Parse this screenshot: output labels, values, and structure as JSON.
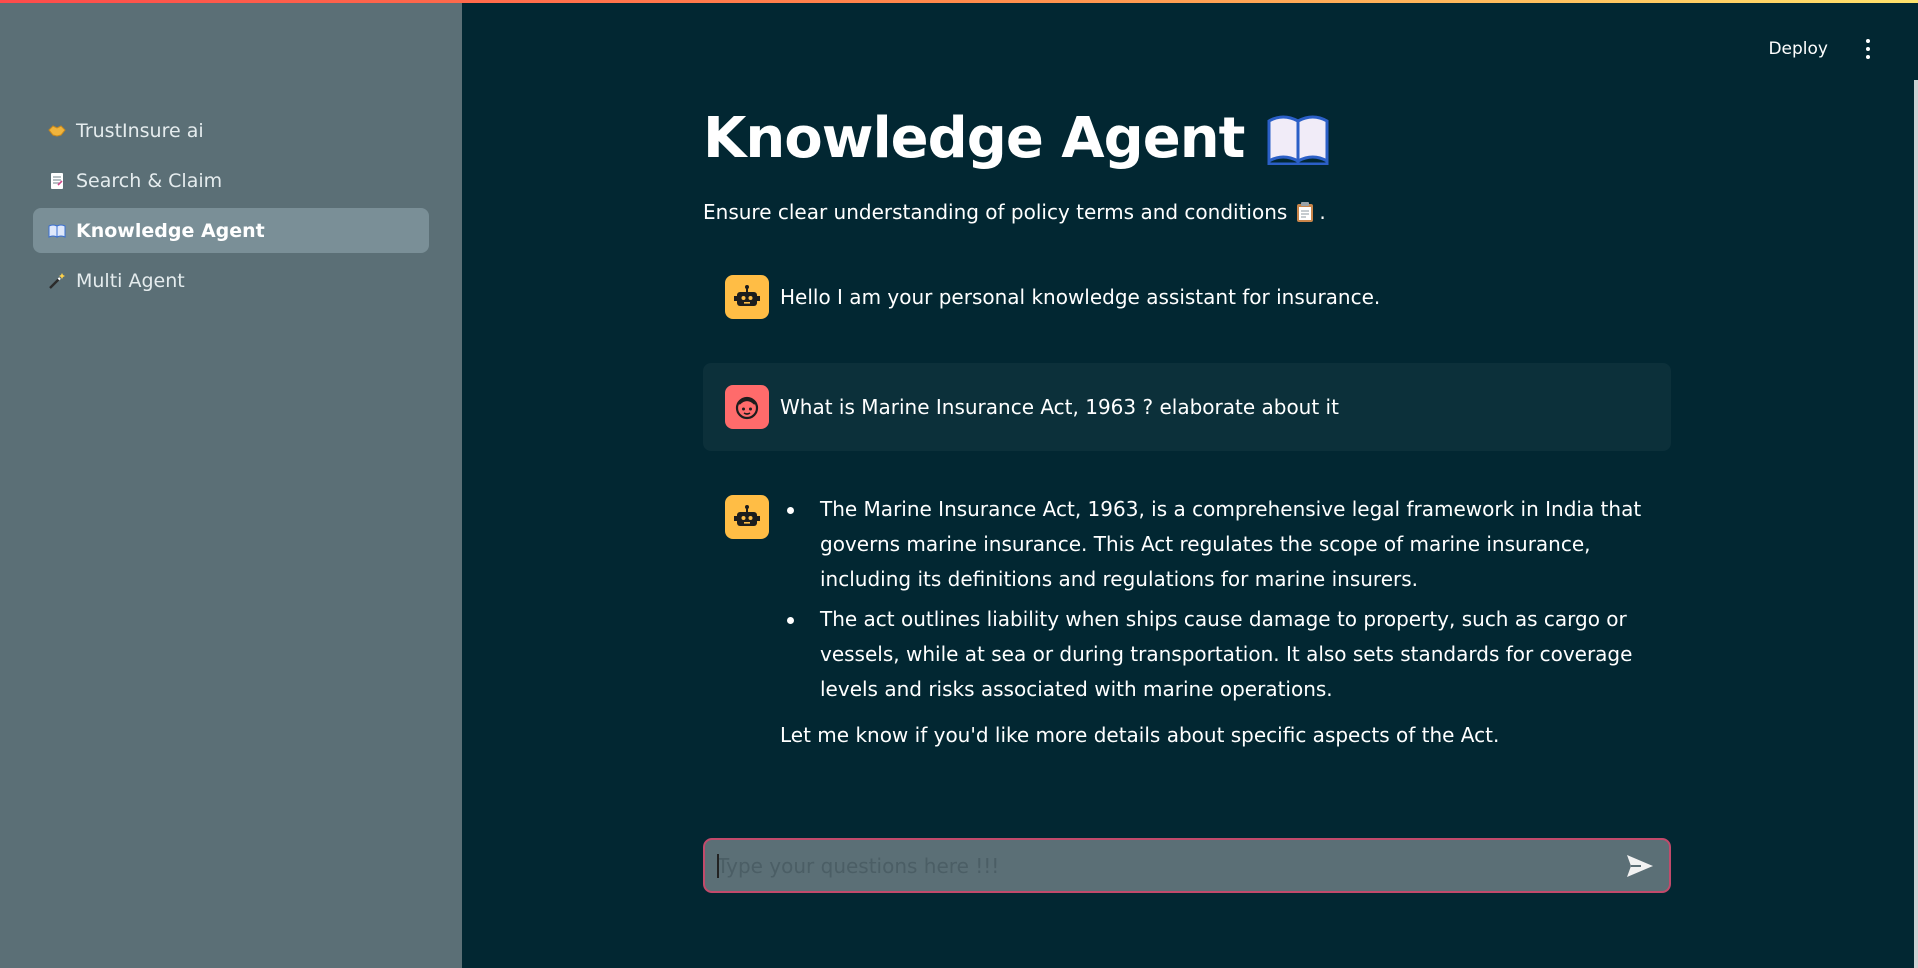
{
  "header": {
    "deploy_label": "Deploy",
    "menu_icon": "kebab-menu-icon"
  },
  "sidebar": {
    "items": [
      {
        "label": "TrustInsure ai",
        "icon": "handshake-icon",
        "active": false
      },
      {
        "label": "Search & Claim",
        "icon": "document-icon",
        "active": false
      },
      {
        "label": "Knowledge Agent",
        "icon": "open-book-icon",
        "active": true
      },
      {
        "label": "Multi Agent",
        "icon": "magic-wand-icon",
        "active": false
      }
    ]
  },
  "main": {
    "title": "Knowledge Agent",
    "title_icon": "open-book-icon",
    "subtitle": "Ensure clear understanding of policy terms and conditions",
    "subtitle_suffix": ".",
    "subtitle_icon": "clipboard-icon"
  },
  "chat": {
    "messages": [
      {
        "role": "assistant",
        "avatar": "robot-icon",
        "text": "Hello I am your personal knowledge assistant for insurance."
      },
      {
        "role": "user",
        "avatar": "face-icon",
        "text": "What is Marine Insurance Act, 1963 ? elaborate about it"
      },
      {
        "role": "assistant",
        "avatar": "robot-icon",
        "bullets": [
          "The Marine Insurance Act, 1963, is a comprehensive legal framework in India that governs marine insurance. This Act regulates the scope of marine insurance, including its definitions and regulations for marine insurers.",
          "The act outlines liability when ships cause damage to property, such as cargo or vessels, while at sea or during transportation. It also sets standards for coverage levels and risks associated with marine operations."
        ],
        "closing": "Let me know if you'd like more details about specific aspects of the Act."
      }
    ],
    "input": {
      "placeholder": "Type your questions here !!!",
      "value": "",
      "send_icon": "send-icon"
    }
  },
  "colors": {
    "main_bg": "#022732",
    "sidebar_bg": "#5b6f76",
    "sidebar_active": "#7a8f97",
    "bot_avatar": "#ffbd45",
    "user_avatar": "#ff6b6b",
    "input_border": "#c24a6b"
  }
}
